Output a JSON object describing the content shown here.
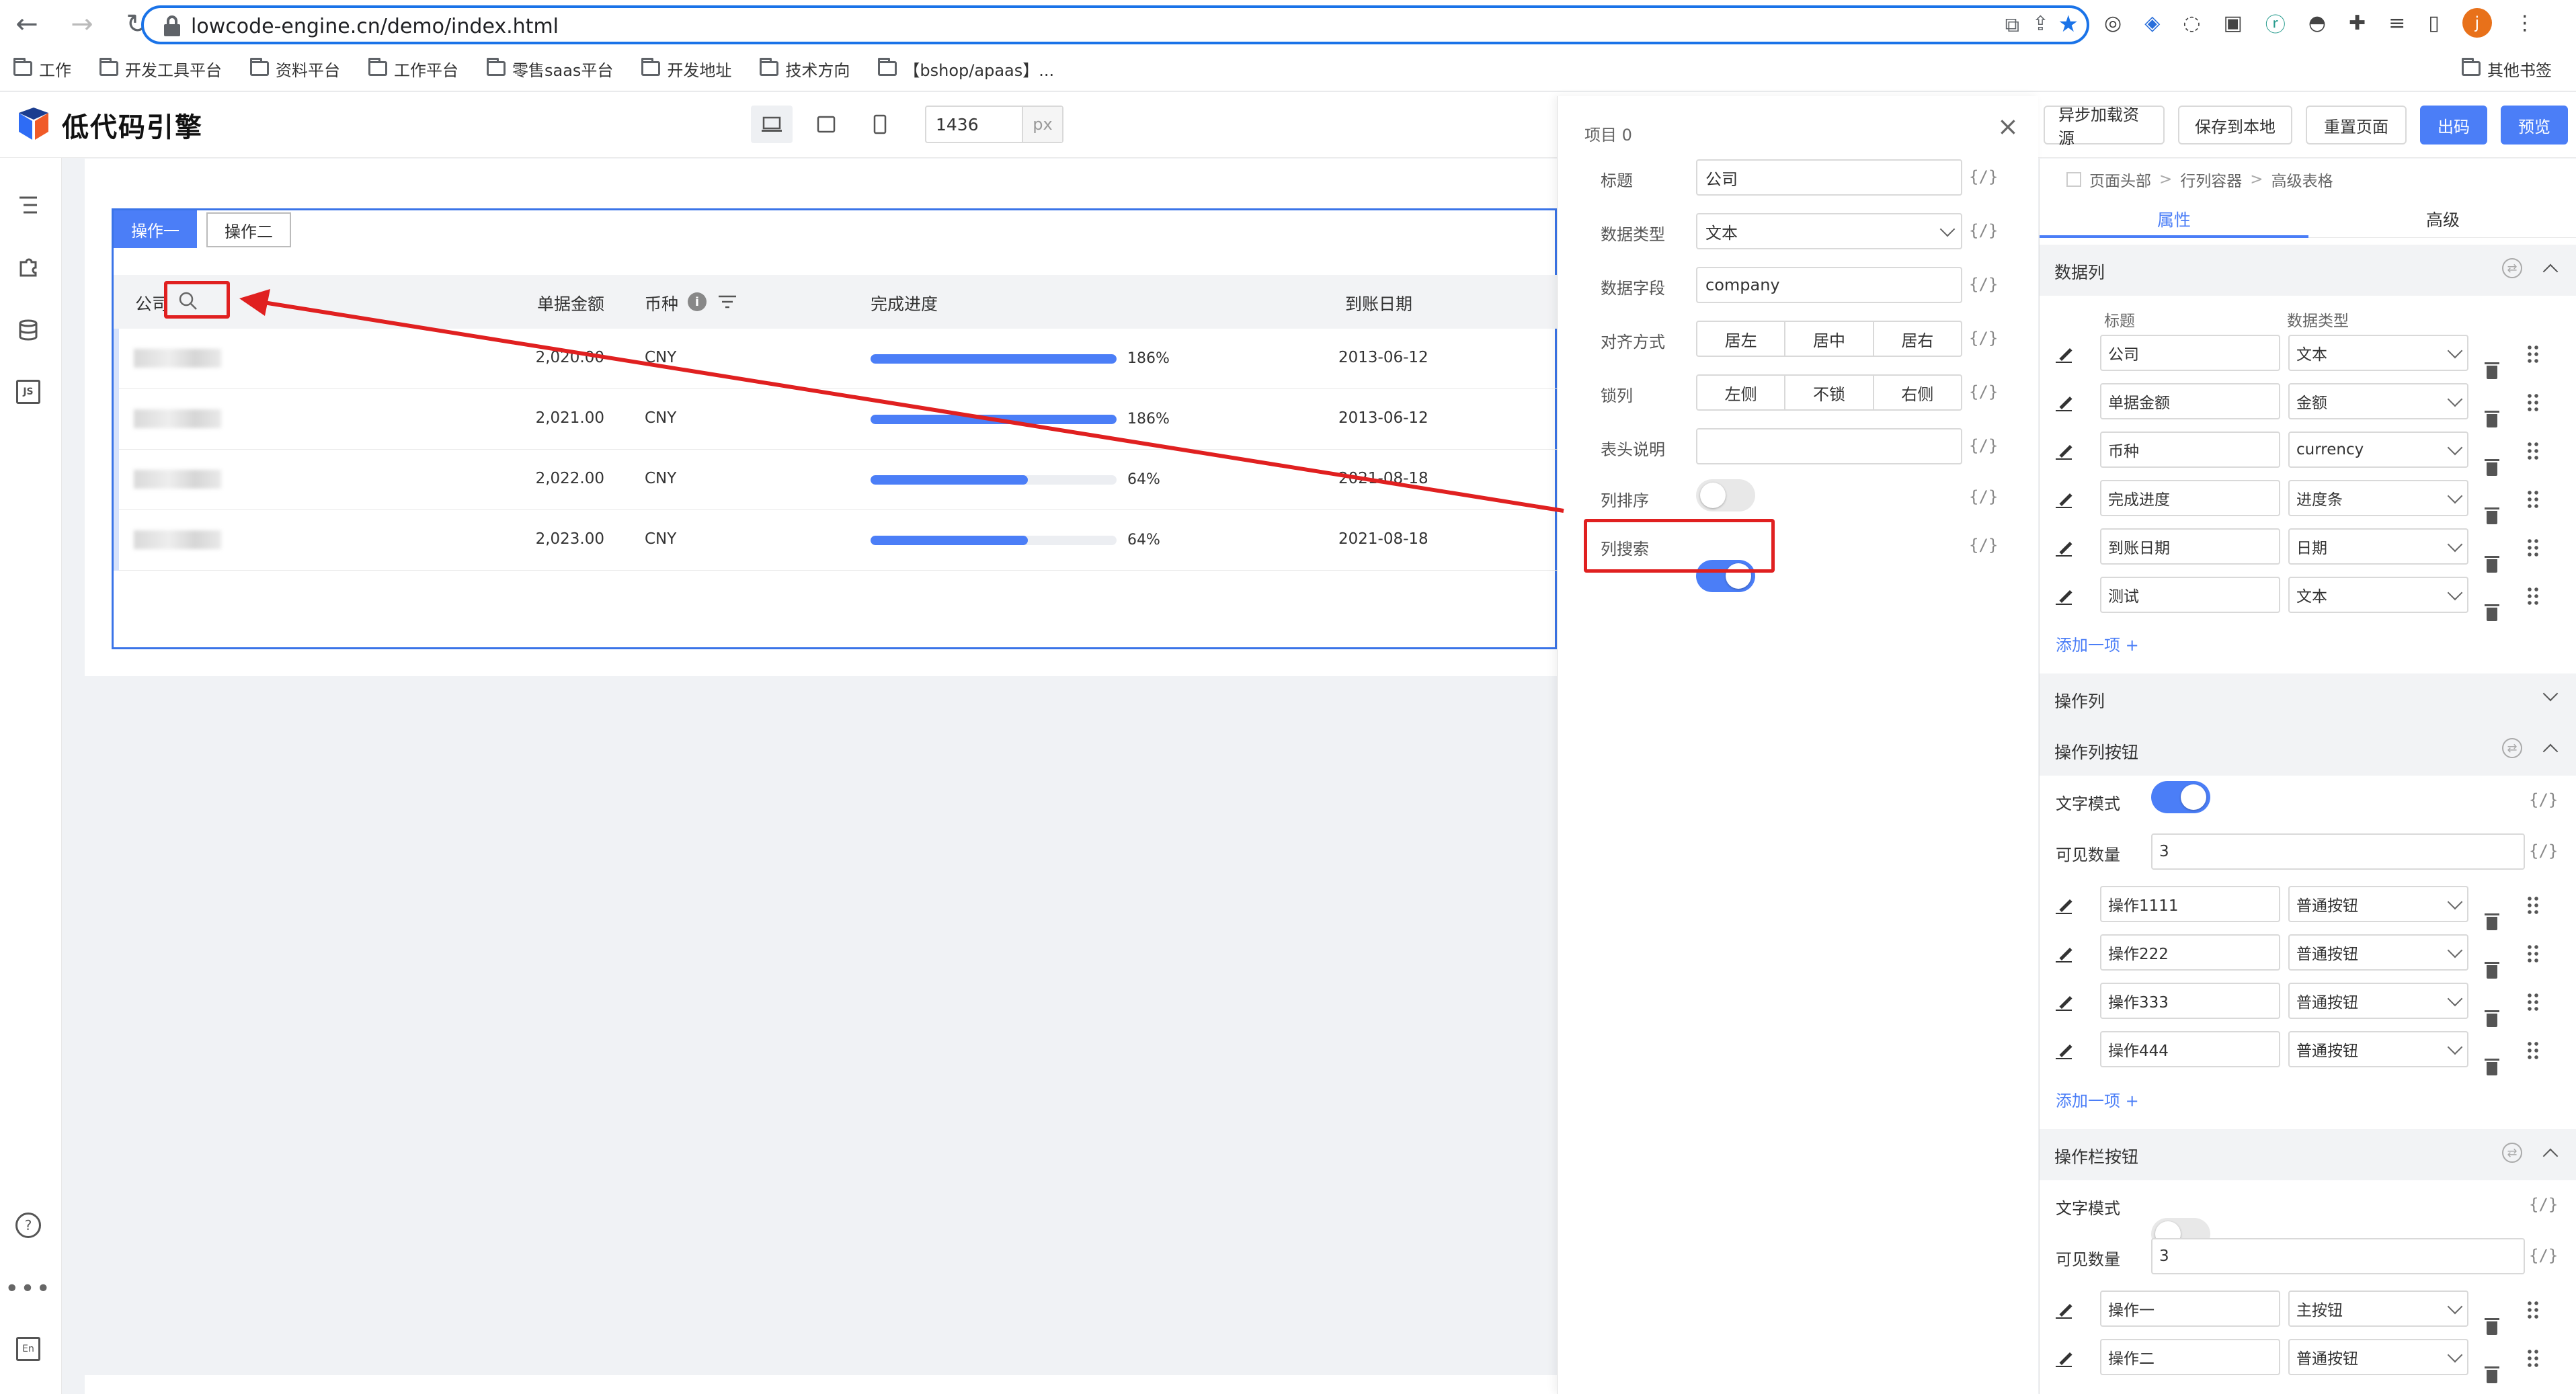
{
  "browser": {
    "url": "lowcode-engine.cn/demo/index.html",
    "bookmarks": [
      "工作",
      "开发工具平台",
      "资料平台",
      "工作平台",
      "零售saas平台",
      "开发地址",
      "技术方向",
      "【bshop/apaas】..."
    ],
    "other_bookmarks": "其他书签",
    "avatar_letter": "j"
  },
  "topbar": {
    "logo_text": "低代码引擎",
    "width_value": "1436",
    "width_unit": "px",
    "buttons": {
      "async_load": "异步加载资源",
      "save_local": "保存到本地",
      "reset_page": "重置页面",
      "export": "出码",
      "preview": "预览"
    }
  },
  "canvas": {
    "tabs": [
      "操作一",
      "操作二"
    ],
    "headers": {
      "company": "公司",
      "amount": "单据金额",
      "currency": "币种",
      "progress": "完成进度",
      "date": "到账日期"
    },
    "rows": [
      {
        "amount": "2,020.00",
        "currency": "CNY",
        "progress_pct": 100,
        "progress_label": "186%",
        "date": "2013-06-12"
      },
      {
        "amount": "2,021.00",
        "currency": "CNY",
        "progress_pct": 100,
        "progress_label": "186%",
        "date": "2013-06-12"
      },
      {
        "amount": "2,022.00",
        "currency": "CNY",
        "progress_pct": 64,
        "progress_label": "64%",
        "date": "2021-08-18"
      },
      {
        "amount": "2,023.00",
        "currency": "CNY",
        "progress_pct": 64,
        "progress_label": "64%",
        "date": "2021-08-18"
      }
    ]
  },
  "popover": {
    "title": "项目 0",
    "var_icon": "{/}",
    "fields": {
      "title_label": "标题",
      "title_value": "公司",
      "dtype_label": "数据类型",
      "dtype_value": "文本",
      "dfield_label": "数据字段",
      "dfield_value": "company",
      "align_label": "对齐方式",
      "align_options": [
        "居左",
        "居中",
        "居右"
      ],
      "lock_label": "锁列",
      "lock_options": [
        "左侧",
        "不锁",
        "右侧"
      ],
      "header_desc_label": "表头说明",
      "header_desc_value": "",
      "sort_label": "列排序",
      "sort_on": false,
      "search_label": "列搜索",
      "search_on": true
    }
  },
  "panel": {
    "breadcrumb": [
      "页面头部",
      "行列容器",
      "高级表格"
    ],
    "tabs": [
      "属性",
      "高级"
    ],
    "var_icon": "{/}",
    "data_columns": {
      "title": "数据列",
      "col_headers": [
        "标题",
        "数据类型"
      ],
      "items": [
        {
          "title": "公司",
          "type": "文本"
        },
        {
          "title": "单据金额",
          "type": "金额"
        },
        {
          "title": "币种",
          "type": "currency"
        },
        {
          "title": "完成进度",
          "type": "进度条"
        },
        {
          "title": "到账日期",
          "type": "日期"
        },
        {
          "title": "测试",
          "type": "文本"
        }
      ],
      "add_label": "添加一项 +"
    },
    "op_column": {
      "title": "操作列"
    },
    "op_column_buttons": {
      "title": "操作列按钮",
      "text_mode_label": "文字模式",
      "text_mode_on": true,
      "visible_count_label": "可见数量",
      "visible_count": "3",
      "items": [
        {
          "title": "操作1111",
          "type": "普通按钮"
        },
        {
          "title": "操作222",
          "type": "普通按钮"
        },
        {
          "title": "操作333",
          "type": "普通按钮"
        },
        {
          "title": "操作444",
          "type": "普通按钮"
        }
      ],
      "add_label": "添加一项 +"
    },
    "toolbar_buttons": {
      "title": "操作栏按钮",
      "text_mode_label": "文字模式",
      "text_mode_on": false,
      "visible_count_label": "可见数量",
      "visible_count": "3",
      "items": [
        {
          "title": "操作一",
          "type": "主按钮"
        },
        {
          "title": "操作二",
          "type": "普通按钮"
        }
      ]
    }
  },
  "colors": {
    "accent": "#4b7ef7",
    "annotation": "#e02020"
  },
  "icons": [
    "back-icon",
    "forward-icon",
    "reload-icon",
    "lock-icon",
    "star-icon",
    "search-icon",
    "info-icon",
    "filter-icon",
    "close-icon",
    "pencil-icon",
    "trash-icon",
    "drag-handle-icon",
    "chevron-down-icon",
    "help-icon",
    "more-icon",
    "language-icon"
  ]
}
